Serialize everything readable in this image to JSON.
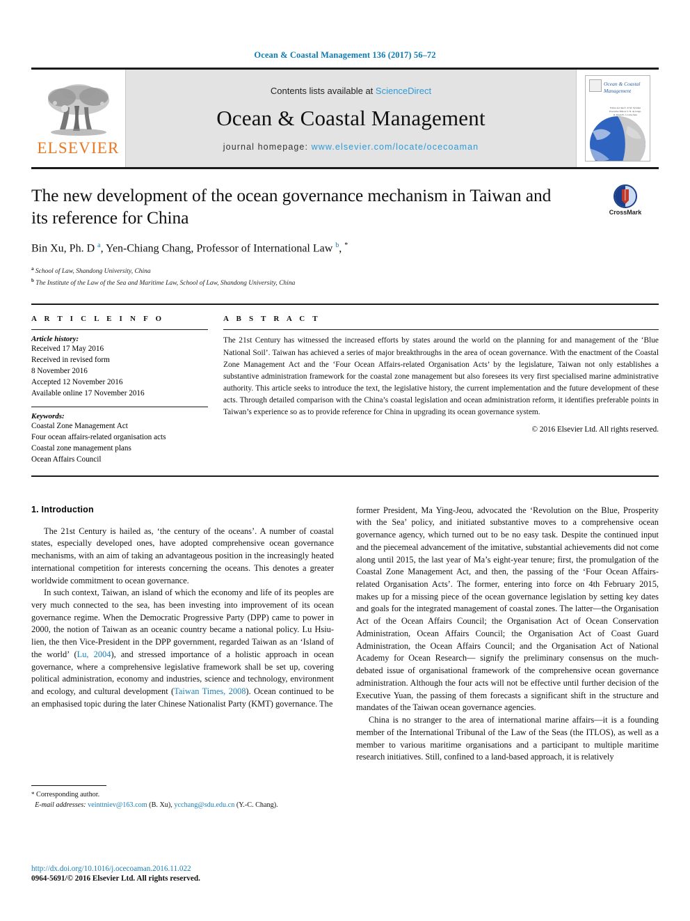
{
  "running_head": "Ocean & Coastal Management 136 (2017) 56–72",
  "masthead": {
    "publisher_name": "ELSEVIER",
    "contents_prefix": "Contents lists available at ",
    "contents_link": "ScienceDirect",
    "journal_name": "Ocean & Coastal Management",
    "homepage_prefix": "journal homepage: ",
    "homepage_link": "www.elsevier.com/locate/ocecoaman",
    "cover_title": "Ocean & Coastal Management",
    "cover_subtitle": "Editor-in-Chief\nJ. P. M. Syvitski\nExecutive Editors\nV. N. de Jonge, R. Klein\nB. J. Cicin-Sain"
  },
  "article": {
    "title": "The new development of the ocean governance mechanism in Taiwan and its reference for China",
    "authors_html": "Bin Xu, Ph. D <sup>a</sup>, Yen-Chiang Chang, Professor of International Law <sup>b</sup>, <sup class=\"star\">*</sup>",
    "affiliations": [
      {
        "marker": "a",
        "text": "School of Law, Shandong University, China"
      },
      {
        "marker": "b",
        "text": "The Institute of the Law of the Sea and Maritime Law, School of Law, Shandong University, China"
      }
    ],
    "crossmark_label": "CrossMark"
  },
  "article_info": {
    "heading": "A R T I C L E   I N F O",
    "history_label": "Article history:",
    "history": [
      "Received 17 May 2016",
      "Received in revised form",
      "8 November 2016",
      "Accepted 12 November 2016",
      "Available online 17 November 2016"
    ],
    "keywords_label": "Keywords:",
    "keywords": [
      "Coastal Zone Management Act",
      "Four ocean affairs-related organisation acts",
      "Coastal zone management plans",
      "Ocean Affairs Council"
    ]
  },
  "abstract": {
    "heading": "A B S T R A C T",
    "text": "The 21st Century has witnessed the increased efforts by states around the world on the planning for and management of the ‘Blue National Soil’. Taiwan has achieved a series of major breakthroughs in the area of ocean governance. With the enactment of the Coastal Zone Management Act and the ‘Four Ocean Affairs-related Organisation Acts’ by the legislature, Taiwan not only establishes a substantive administration framework for the coastal zone management but also foresees its very first specialised marine administrative authority. This article seeks to introduce the text, the legislative history, the current implementation and the future development of these acts. Through detailed comparison with the China’s coastal legislation and ocean administration reform, it identifies preferable points in Taiwan’s experience so as to provide reference for China in upgrading its ocean governance system.",
    "copyright": "© 2016 Elsevier Ltd. All rights reserved."
  },
  "body": {
    "section_number_title": "1. Introduction",
    "left_paragraphs": [
      "The 21st Century is hailed as, ‘the century of the oceans’. A number of coastal states, especially developed ones, have adopted comprehensive ocean governance mechanisms, with an aim of taking an advantageous position in the increasingly heated international competition for interests concerning the oceans. This denotes a greater worldwide commitment to ocean governance."
    ],
    "left_paragraph_2_pre": "In such context, Taiwan, an island of which the economy and life of its peoples are very much connected to the sea, has been investing into improvement of its ocean governance regime. When the Democratic Progressive Party (DPP) came to power in 2000, the notion of Taiwan as an oceanic country became a national policy. Lu Hsiu-lien, the then Vice-President in the DPP government, regarded Taiwan as an ‘Island of the world’ (",
    "citation_1": "Lu, 2004",
    "left_paragraph_2_mid": "), and stressed importance of a holistic approach in ocean governance, where a comprehensive legislative framework shall be set up, covering political administration, economy and industries, science and technology, environment and ecology, and cultural development (",
    "citation_2": "Taiwan Times, 2008",
    "left_paragraph_2_post": "). Ocean continued to be an emphasised topic during the later Chinese Nationalist Party (KMT) governance. The",
    "right_paragraphs": [
      "former President, Ma Ying-Jeou, advocated the ‘Revolution on the Blue, Prosperity with the Sea’ policy, and initiated substantive moves to a comprehensive ocean governance agency, which turned out to be no easy task. Despite the continued input and the piecemeal advancement of the imitative, substantial achievements did not come along until 2015, the last year of Ma’s eight-year tenure; first, the promulgation of the Coastal Zone Management Act, and then, the passing of the ‘Four Ocean Affairs-related Organisation Acts’. The former, entering into force on 4th February 2015, makes up for a missing piece of the ocean governance legislation by setting key dates and goals for the integrated management of coastal zones. The latter—the Organisation Act of the Ocean Affairs Council; the Organisation Act of Ocean Conservation Administration, Ocean Affairs Council; the Organisation Act of Coast Guard Administration, the Ocean Affairs Council; and the Organisation Act of National Academy for Ocean Research— signify the preliminary consensus on the much-debated issue of organisational framework of the comprehensive ocean governance administration. Although the four acts will not be effective until further decision of the Executive Yuan, the passing of them forecasts a significant shift in the structure and mandates of the Taiwan ocean governance agencies.",
      "China is no stranger to the area of international marine affairs—it is a founding member of the International Tribunal of the Law of the Seas (the ITLOS), as well as a member to various maritime organisations and a participant to multiple maritime research initiatives. Still, confined to a land-based approach, it is relatively"
    ]
  },
  "footnote": {
    "corresponding_star": "*",
    "corresponding_label": "Corresponding author.",
    "email_label": "E-mail addresses:",
    "email_1": "veinttniev@163.com",
    "email_1_owner": "(B. Xu)",
    "email_2": "ycchang@sdu.edu.cn",
    "email_2_owner": "(Y.-C. Chang)."
  },
  "footer": {
    "doi": "http://dx.doi.org/10.1016/j.ocecoaman.2016.11.022",
    "issn_line": "0964-5691/© 2016 Elsevier Ltd. All rights reserved."
  },
  "colors": {
    "link_blue": "#1a7fb5",
    "elsevier_orange": "#e87722",
    "header_blue": "#0b7bb5"
  }
}
